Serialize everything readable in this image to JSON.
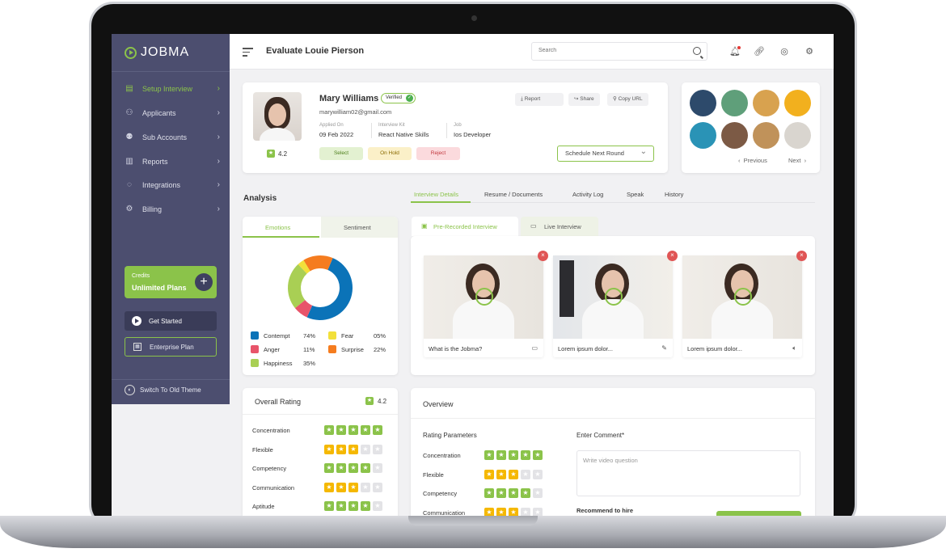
{
  "app": {
    "logo": "JOBMA"
  },
  "sidebar": {
    "items": [
      {
        "label": "Setup Interview",
        "icon": "setup-interview-icon"
      },
      {
        "label": "Applicants",
        "icon": "applicants-icon"
      },
      {
        "label": "Sub Accounts",
        "icon": "sub-accounts-icon"
      },
      {
        "label": "Reports",
        "icon": "reports-icon"
      },
      {
        "label": "Integrations",
        "icon": "integrations-icon"
      },
      {
        "label": "Billing",
        "icon": "billing-icon"
      }
    ],
    "credits_label": "Credits",
    "credits_value": "Unlimited Plans",
    "get_started": "Get Started",
    "enterprise": "Enterprise Plan",
    "switch_theme": "Switch To Old Theme"
  },
  "header": {
    "title": "Evaluate Louie Pierson",
    "search_placeholder": "Search"
  },
  "candidate": {
    "name": "Mary Williams",
    "verified": "Verified",
    "email": "marywilliam02@gmail.com",
    "rating": "4.2",
    "applied_label": "Applied On",
    "applied_value": "09 Feb 2022",
    "kit_label": "Interview Kit",
    "kit_value": "React Native Skills",
    "job_label": "Job",
    "job_value": "Ios Developer",
    "select": "Select",
    "on_hold": "On Hold",
    "reject": "Reject",
    "report": "Report",
    "share": "Share",
    "copy_url": "Copy URL",
    "schedule": "Schedule Next Round"
  },
  "pager": {
    "previous": "Previous",
    "next": "Next"
  },
  "analysis": {
    "title": "Analysis",
    "tab_emotions": "Emotions",
    "tab_sentiment": "Sentiment",
    "legend": [
      {
        "label": "Contempt",
        "value": "74%",
        "color": "#0b73b8"
      },
      {
        "label": "Fear",
        "value": "05%",
        "color": "#f2e03a"
      },
      {
        "label": "Anger",
        "value": "11%",
        "color": "#e8546a"
      },
      {
        "label": "Surprise",
        "value": "22%",
        "color": "#f57c1f"
      },
      {
        "label": "Happiness",
        "value": "35%",
        "color": "#a9cf54"
      }
    ]
  },
  "chart_data": {
    "type": "pie",
    "categories": [
      "Contempt",
      "Fear",
      "Anger",
      "Surprise",
      "Happiness"
    ],
    "values": [
      74,
      5,
      11,
      22,
      35
    ]
  },
  "details_tabs": [
    "Interview Details",
    "Resume / Documents",
    "Activity Log",
    "Speak",
    "History"
  ],
  "interview_tabs": {
    "pre": "Pre-Recorded Interview",
    "live": "Live Interview"
  },
  "videos": [
    {
      "caption": "What is the Jobma?",
      "icon": "video-camera-icon"
    },
    {
      "caption": "Lorem ipsum dolor...",
      "icon": "pencil-icon"
    },
    {
      "caption": "Lorem ipsum dolor...",
      "icon": "speaker-icon"
    }
  ],
  "overall": {
    "title": "Overall Rating",
    "rating": "4.2",
    "rows": [
      {
        "label": "Concentration",
        "stars": 5,
        "color": "green"
      },
      {
        "label": "Flexible",
        "stars": 3,
        "color": "yellow"
      },
      {
        "label": "Competency",
        "stars": 4,
        "color": "green"
      },
      {
        "label": "Communication",
        "stars": 3,
        "color": "yellow"
      },
      {
        "label": "Aptitude",
        "stars": 4,
        "color": "green"
      }
    ]
  },
  "overview": {
    "title": "Overview",
    "params_title": "Rating Parameters",
    "comment_label": "Enter Comment*",
    "comment_placeholder": "Write video question",
    "recommend": "Recommend to hire",
    "rows": [
      {
        "label": "Concentration",
        "stars": 5,
        "color": "green"
      },
      {
        "label": "Flexible",
        "stars": 3,
        "color": "yellow"
      },
      {
        "label": "Competency",
        "stars": 4,
        "color": "green"
      },
      {
        "label": "Communication",
        "stars": 3,
        "color": "yellow"
      }
    ]
  },
  "colors": {
    "accent": "#8bc34a",
    "sidebar": "#4c4e6f",
    "danger": "#e05555"
  }
}
